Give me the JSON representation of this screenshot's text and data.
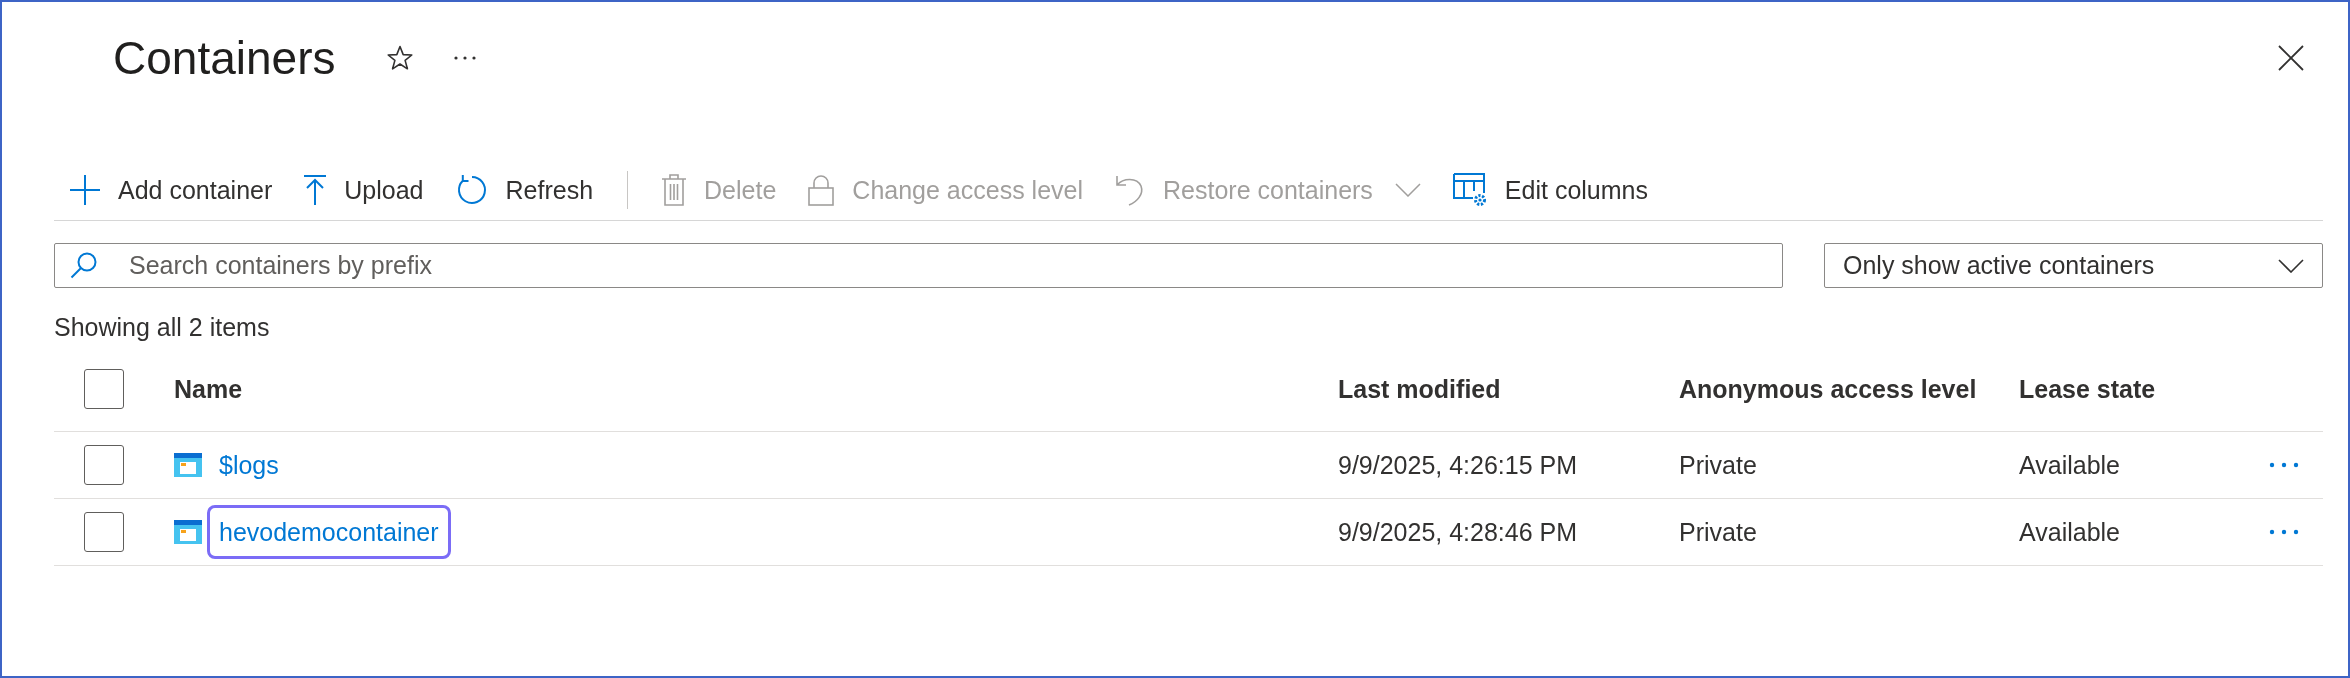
{
  "blade": {
    "title": "Containers",
    "favorite": false
  },
  "toolbar": {
    "groups": [
      [
        {
          "label": "Add container",
          "kind": "button",
          "disabled": false
        },
        {
          "label": "Upload",
          "kind": "button",
          "disabled": false
        },
        {
          "label": "Refresh",
          "kind": "button",
          "disabled": false
        }
      ],
      [
        {
          "label": "Delete",
          "kind": "button",
          "disabled": true
        },
        {
          "label": "Change access level",
          "kind": "button",
          "disabled": true
        },
        {
          "label": "Restore containers",
          "kind": "menu",
          "disabled": true
        },
        {
          "label": "Edit columns",
          "kind": "button",
          "disabled": false
        }
      ]
    ]
  },
  "search": {
    "placeholder": "Search containers by prefix"
  },
  "filter": {
    "value": "Only show active containers"
  },
  "summary": "Showing all 2 items",
  "table": {
    "select_all": {
      "checked": false
    },
    "columns": [
      "Name",
      "Last modified",
      "Anonymous access level",
      "Lease state"
    ],
    "rows": [
      {
        "checked": false,
        "highlighted": false,
        "name": "$logs",
        "last_modified": "9/9/2025, 4:26:15 PM",
        "access_level": "Private",
        "lease_state": "Available"
      },
      {
        "checked": false,
        "highlighted": true,
        "name": "hevodemocontainer",
        "last_modified": "9/9/2025, 4:28:46 PM",
        "access_level": "Private",
        "lease_state": "Available"
      }
    ]
  }
}
